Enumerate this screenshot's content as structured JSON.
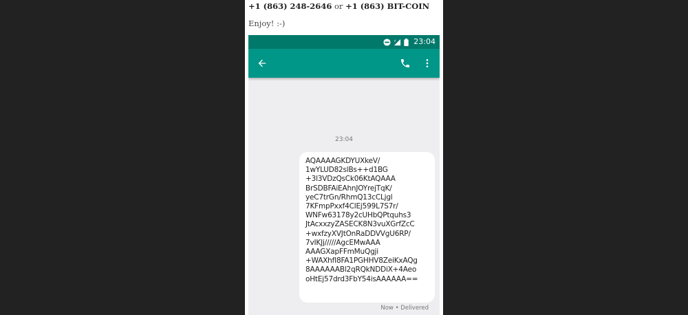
{
  "doc": {
    "phone_number": "+1 (863) 248-2646",
    "connector": "or",
    "phone_alias": "+1 (863) BIT-COIN",
    "closing": "Enjoy! :-)"
  },
  "phone": {
    "status_bar": {
      "time": "23:04",
      "icons": [
        "do-not-disturb-icon",
        "signal-icon",
        "battery-icon"
      ],
      "color": "#00796b"
    },
    "app_bar": {
      "color": "#009688",
      "icons": [
        "back-arrow-icon",
        "phone-call-icon",
        "more-vert-icon"
      ]
    },
    "conversation": {
      "timestamp": "23:04",
      "message_lines": [
        "AQAAAAGKDYUXkeV/",
        "1wYLUD82slBs++d1BG",
        "+3l3VDzQsCk06KtAQAAA",
        "BrSDBFAiEAhnJOYrejTqK/",
        "yeC7trGn/RhmQ13cCLjgl",
        "7KFmpPxxf4ClEj599L7S7r/",
        "WNFw63178y2cUHbQPtquhs3",
        "JtAcxxzyZASECK8N3vuXGrfZcC",
        "+wxfzyXVJtOnRaDDVVgU6RP/",
        "7vIKJj/////AgcEMwAAA",
        "AAAGXapFFmMuQgji",
        "+WAXhfI8FA1PGHHV8ZeiKxAQg",
        "8AAAAAABl2qRQkNDDiX+4Aeo",
        "oHtEj57drd3FbY54isAAAAAA=="
      ],
      "delivery_status": "Now • Delivered"
    }
  }
}
